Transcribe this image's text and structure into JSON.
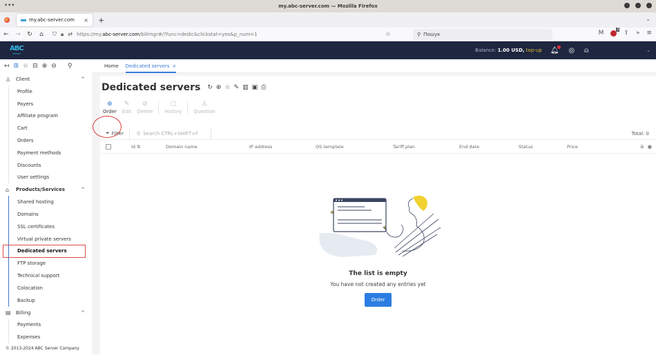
{
  "window": {
    "title": "my.abc-server.com — Mozilla Firefox",
    "menu_dots": "•••"
  },
  "browser": {
    "tab_title": "my.abc-server.com",
    "tab_close": "×",
    "new_tab": "+",
    "url_prefix": "https://my.",
    "url_domain": "abc-server.com",
    "url_path": "/billmgr#/?func=dedic&clickstat=yes&p_num=1",
    "search_placeholder": "Пошук",
    "extension_badge": "2"
  },
  "header": {
    "logo_text": "ABC",
    "logo_sub": "SERVER",
    "balance_label": "Balance:",
    "balance_value": "1.00 USD,",
    "topup_label": "top-up",
    "notification_badge_color": "#e8333c",
    "background_color": "#1e2640"
  },
  "breadcrumbs": {
    "home": "Home",
    "current": "Dedicated servers",
    "close": "×"
  },
  "sidebar": {
    "groups": [
      {
        "label": "Client",
        "icon": "user-icon",
        "expanded": true,
        "items": [
          "Profile",
          "Payers",
          "Affiliate program",
          "Cart",
          "Orders",
          "Payment methods",
          "Discounts",
          "User settings"
        ]
      },
      {
        "label": "Products/Services",
        "icon": "basket-icon",
        "expanded": true,
        "items": [
          "Shared hosting",
          "Domains",
          "SSL certificates",
          "Virtual private servers",
          "Dedicated servers",
          "FTP storage",
          "Technical support",
          "Colocation",
          "Backup"
        ],
        "current": "Dedicated servers"
      },
      {
        "label": "Billing",
        "icon": "wallet-icon",
        "expanded": true,
        "items": [
          "Payments",
          "Expenses"
        ]
      }
    ],
    "copyright": "© 2013-2024 ABC Server Company"
  },
  "page": {
    "title": "Dedicated servers",
    "actions": [
      {
        "label": "Order",
        "icon": "plus-circle-icon",
        "enabled": true
      },
      {
        "label": "Edit",
        "icon": "pencil-icon",
        "enabled": false
      },
      {
        "label": "Delete",
        "icon": "trash-icon",
        "enabled": false
      },
      {
        "label": "History",
        "icon": "history-icon",
        "enabled": false
      },
      {
        "label": "Question",
        "icon": "question-icon",
        "enabled": false
      }
    ],
    "filter_label": "Filter",
    "search_placeholder": "Search CTRL+SHIFT+F",
    "total_label": "Total: 0",
    "columns": [
      "Id",
      "Domain name",
      "IP address",
      "OS template",
      "Tariff plan",
      "End date",
      "Status",
      "Price"
    ],
    "empty_title": "The list is empty",
    "empty_text": "You have not created any entries yet",
    "empty_button": "Order",
    "accent_color": "#2b7de1",
    "highlight_color": "#d83a3a"
  }
}
